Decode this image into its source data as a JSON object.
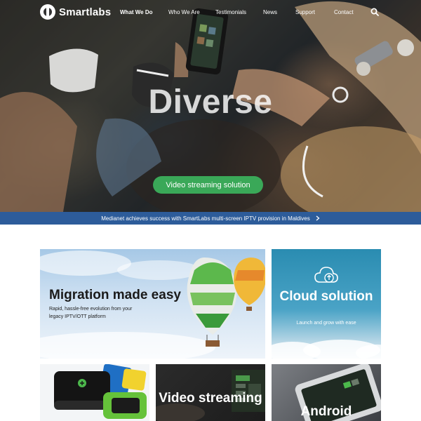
{
  "brand": {
    "name": "Smartlabs"
  },
  "nav": {
    "items": [
      {
        "label": "What We Do",
        "active": true
      },
      {
        "label": "Who We Are",
        "active": false
      },
      {
        "label": "Testimonials",
        "active": false
      },
      {
        "label": "News",
        "active": false
      },
      {
        "label": "Support",
        "active": false
      },
      {
        "label": "Contact",
        "active": false
      }
    ],
    "search_icon": "search-icon"
  },
  "hero": {
    "title": "Diverse",
    "button_label": "Video streaming solution",
    "button_color": "#3aa858"
  },
  "banner": {
    "text": "Medianet achieves success with SmartLabs multi-screen IPTV provision in Maldives",
    "icon": "chevron-right-icon",
    "color": "#2d5c9a"
  },
  "cards": {
    "migration": {
      "title": "Migration made easy",
      "subtitle": "Rapid, hassle-free evolution from your legacy IPTV/OTT platform"
    },
    "cloud": {
      "title": "Cloud solution",
      "subtitle": "Launch and grow with ease",
      "icon": "cloud-upload-icon"
    },
    "devices": {
      "icon": "set-top-box-icon"
    },
    "video": {
      "title": "Video streaming"
    },
    "android": {
      "title": "Android"
    }
  }
}
